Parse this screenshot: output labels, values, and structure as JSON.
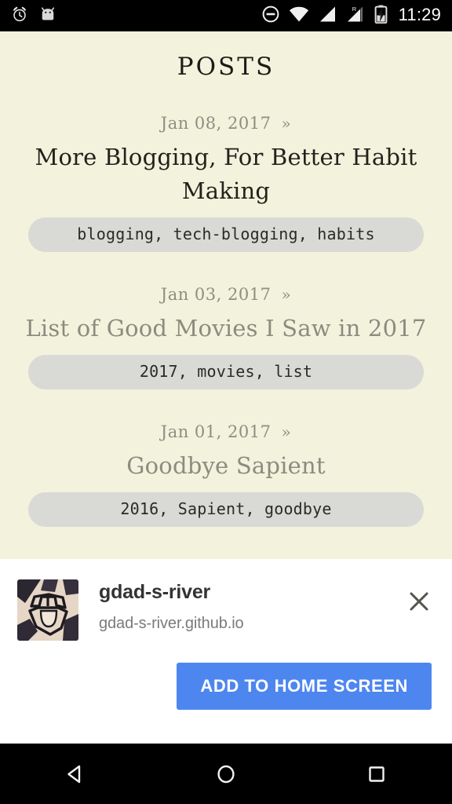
{
  "statusbar": {
    "time": "11:29",
    "icons": [
      {
        "name": "alarm-clock-icon"
      },
      {
        "name": "android-head-icon"
      },
      {
        "name": "do-not-disturb-icon"
      },
      {
        "name": "wifi-icon"
      },
      {
        "name": "cellular-signal-icon"
      },
      {
        "name": "roaming-signal-icon"
      },
      {
        "name": "battery-charging-icon"
      }
    ]
  },
  "page": {
    "title": "POSTS",
    "background_color": "#F3F2DC"
  },
  "posts": [
    {
      "date": "Jan 08, 2017",
      "chevron": "»",
      "title": "More Blogging, For Better Habit Making",
      "tags": "blogging, tech-blogging, habits",
      "title_style": "dark"
    },
    {
      "date": "Jan 03, 2017",
      "chevron": "»",
      "title": "List of Good Movies I Saw in 2017",
      "tags": "2017, movies, list",
      "title_style": "light"
    },
    {
      "date": "Jan 01, 2017",
      "chevron": "»",
      "title": "Goodbye Sapient",
      "tags": "2016, Sapient, goodbye",
      "title_style": "light"
    }
  ],
  "banner": {
    "app_name": "gdad-s-river",
    "app_url": "gdad-s-river.github.io",
    "close_icon": "close-icon",
    "avatar_icon": "avatar",
    "add_button_label": "ADD TO HOME SCREEN",
    "add_button_color": "#4d86ef"
  },
  "navbar": {
    "back_label": "Back",
    "home_label": "Home",
    "recents_label": "Recent apps"
  }
}
